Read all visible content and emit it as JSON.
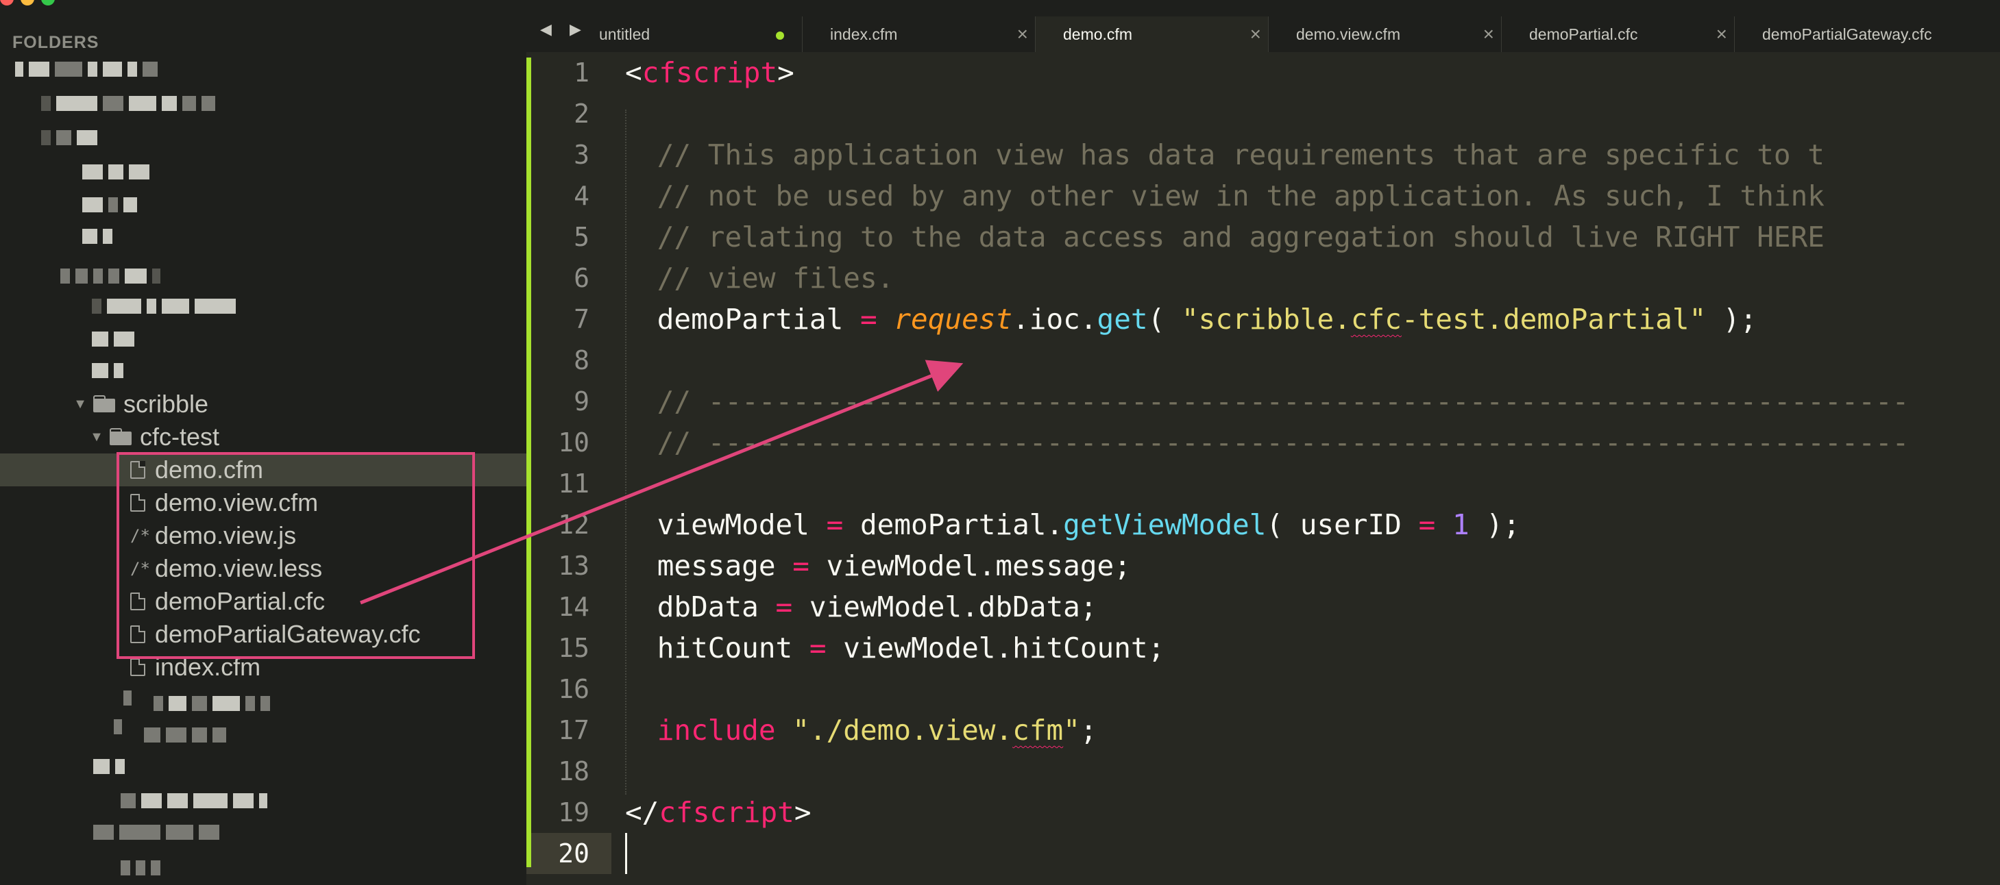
{
  "sidebar": {
    "title": "FOLDERS",
    "tree": [
      {
        "label": "scribble",
        "kind": "folder"
      },
      {
        "label": "cfc-test",
        "kind": "folder"
      },
      {
        "label": "demo.cfm",
        "kind": "file"
      },
      {
        "label": "demo.view.cfm",
        "kind": "file"
      },
      {
        "label": "demo.view.js",
        "kind": "comment-file"
      },
      {
        "label": "demo.view.less",
        "kind": "comment-file"
      },
      {
        "label": "demoPartial.cfc",
        "kind": "file"
      },
      {
        "label": "demoPartialGateway.cfc",
        "kind": "file"
      },
      {
        "label": "index.cfm",
        "kind": "file"
      }
    ]
  },
  "tabs": [
    {
      "label": "untitled",
      "dirty": true
    },
    {
      "label": "index.cfm"
    },
    {
      "label": "demo.cfm",
      "active": true
    },
    {
      "label": "demo.view.cfm"
    },
    {
      "label": "demoPartial.cfc"
    },
    {
      "label": "demoPartialGateway.cfc"
    }
  ],
  "tab_nav": "◀ ▶",
  "tab_close_glyph": "×",
  "editor": {
    "current_line": 20,
    "line_numbers": [
      "1",
      "2",
      "3",
      "4",
      "5",
      "6",
      "7",
      "8",
      "9",
      "10",
      "11",
      "12",
      "13",
      "14",
      "15",
      "16",
      "17",
      "18",
      "19",
      "20"
    ],
    "code": {
      "l1_open": "<",
      "l1_tag": "cfscript",
      "l1_close": ">",
      "l3": "    // This application view has data requirements that are specific to t",
      "l4": "    // not be used by any other view in the application. As such, I think",
      "l5": "    // relating to the data access and aggregation should live RIGHT HERE",
      "l6": "    // view files.",
      "l7_a": "    demoPartial ",
      "l7_eq": "=",
      "l7_req": "request",
      "l7_b": ".ioc.",
      "l7_get": "get",
      "l7_c": "( ",
      "l7_s1": "\"scribble.",
      "l7_s2": "cfc",
      "l7_s3": "-test.demoPartial\"",
      "l7_d": " );",
      "l9": "    // -----------------------------------------------------------------------",
      "l10": "    // -----------------------------------------------------------------------",
      "l12_a": "    viewModel ",
      "l12_eq": "=",
      "l12_b": " demoPartial.",
      "l12_fn": "getViewModel",
      "l12_c": "( userID ",
      "l12_eq2": "=",
      "l12_num": "1",
      "l12_d": " );",
      "l13_a": "    message ",
      "l13_b": " viewModel.message;",
      "l14_a": "    dbData ",
      "l14_b": " viewModel.dbData;",
      "l15_a": "    hitCount ",
      "l15_b": " viewModel.hitCount;",
      "eq": "=",
      "l17_kw": "include",
      "l17_s1": "\"./demo.view.",
      "l17_s2": "cfm",
      "l17_s3": "\"",
      "l17_end": ";",
      "l19_open": "</",
      "l19_tag": "cfscript",
      "l19_close": ">"
    }
  },
  "colors": {
    "annotation": "#e0457b",
    "gutter_bar": "#a6e22e"
  },
  "icons": [
    "folder-icon",
    "file-icon",
    "comment-file-icon",
    "tab-close-icon",
    "dirty-dot-icon",
    "arrow-annotation"
  ]
}
